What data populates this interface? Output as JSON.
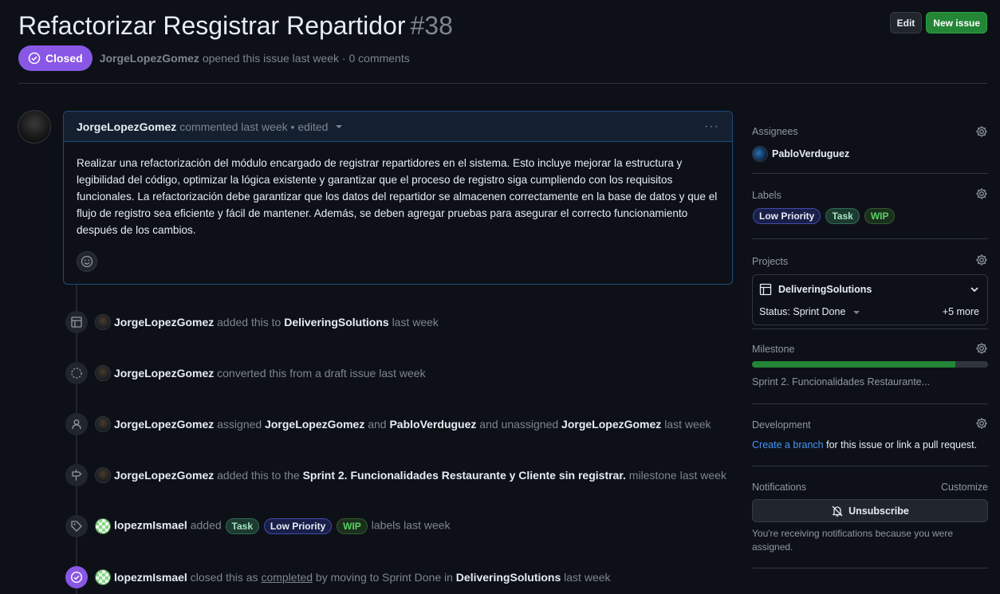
{
  "issue": {
    "title": "Refactorizar Resgistrar Repartidor",
    "number": "#38",
    "state": "Closed",
    "author": "JorgeLopezGomez",
    "opened_meta": " opened this issue last week · 0 comments"
  },
  "header_buttons": {
    "edit": "Edit",
    "new_issue": "New issue"
  },
  "comment": {
    "author": "JorgeLopezGomez",
    "meta": "commented last week • edited",
    "body": "Realizar una refactorización del módulo encargado de registrar repartidores en el sistema. Esto incluye mejorar la estructura y legibilidad del código, optimizar la lógica existente y garantizar que el proceso de registro siga cumpliendo con los requisitos funcionales. La refactorización debe garantizar que los datos del repartidor se almacenen correctamente en la base de datos y que el flujo de registro sea eficiente y fácil de mantener. Además, se deben agregar pruebas para asegurar el correcto funcionamiento después de los cambios."
  },
  "timeline": [
    {
      "icon": "table-icon",
      "actor": "JorgeLopezGomez",
      "t1": "added this to",
      "b1": "DeliveringSolutions",
      "t2": "last week"
    },
    {
      "icon": "issue-draft-icon",
      "actor": "JorgeLopezGomez",
      "t1": "converted this from a draft issue last week"
    },
    {
      "icon": "person-icon",
      "actor": "JorgeLopezGomez",
      "t1": "assigned",
      "b1": "JorgeLopezGomez",
      "t2": "and",
      "b2": "PabloVerduguez",
      "t3": "and unassigned",
      "b3": "JorgeLopezGomez",
      "t4": "last week"
    },
    {
      "icon": "milestone-icon",
      "actor": "JorgeLopezGomez",
      "t1": "added this to the",
      "b1": "Sprint 2. Funcionalidades Restaurante y Cliente sin registrar.",
      "t2": "milestone last week"
    },
    {
      "icon": "tag-icon",
      "actor": "lopezmIsmael",
      "t1": "added",
      "labels": [
        "Task",
        "Low Priority",
        "WIP"
      ],
      "t2": "labels last week"
    },
    {
      "icon": "check-circle-icon",
      "actor": "lopezmIsmael",
      "t1": "closed this as",
      "link": "completed",
      "t2": "by moving to Sprint Done in",
      "b1": "DeliveringSolutions",
      "t3": "last week"
    }
  ],
  "sidebar": {
    "assignees_title": "Assignees",
    "assignee": "PabloVerduguez",
    "labels_title": "Labels",
    "labels": [
      "Low Priority",
      "Task",
      "WIP"
    ],
    "projects_title": "Projects",
    "project_name": "DeliveringSolutions",
    "project_status": "Status: Sprint Done",
    "project_more": "+5 more",
    "milestone_title": "Milestone",
    "milestone_name": "Sprint 2. Funcionalidades Restaurante...",
    "milestone_progress": 0.86,
    "development_title": "Development",
    "development_link": "Create a branch",
    "development_text": " for this issue or link a pull request.",
    "notifications_title": "Notifications",
    "customize": "Customize",
    "unsubscribe": "Unsubscribe",
    "notif_note": "You're receiving notifications because you were assigned."
  },
  "colors": {
    "closed": "#8957e5",
    "new_issue": "#238636",
    "link": "#4493f8",
    "background": "#0d1117"
  }
}
